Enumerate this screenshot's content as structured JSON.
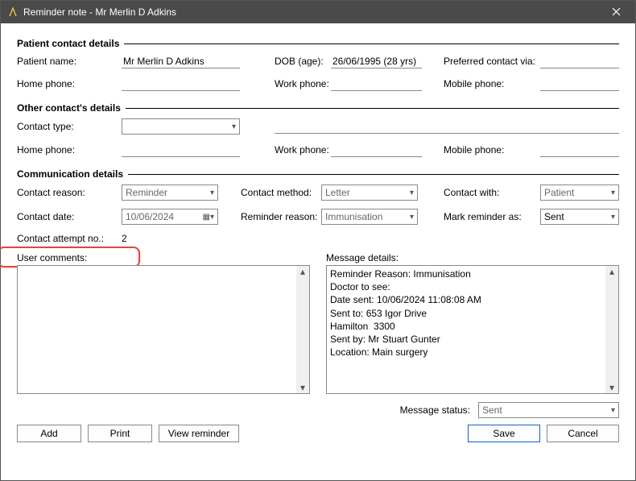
{
  "window": {
    "title": "Reminder note - Mr Merlin D Adkins"
  },
  "sections": {
    "patient": "Patient contact details",
    "other": "Other contact's details",
    "comm": "Communication details"
  },
  "labels": {
    "patient_name": "Patient name:",
    "dob": "DOB (age):",
    "preferred_contact": "Preferred contact via:",
    "home_phone": "Home phone:",
    "work_phone": "Work phone:",
    "mobile_phone": "Mobile phone:",
    "contact_type": "Contact type:",
    "contact_reason": "Contact reason:",
    "contact_method": "Contact method:",
    "contact_with": "Contact with:",
    "contact_date": "Contact date:",
    "reminder_reason": "Reminder reason:",
    "mark_reminder_as": "Mark reminder as:",
    "contact_attempt": "Contact attempt no.:",
    "user_comments": "User comments:",
    "message_details": "Message details:",
    "message_status": "Message status:"
  },
  "values": {
    "patient_name": "Mr Merlin D Adkins",
    "dob": "26/06/1995 (28 yrs)",
    "preferred_contact": "",
    "p_home_phone": "",
    "p_work_phone": "",
    "p_mobile_phone": "",
    "contact_type": "",
    "other_name": "",
    "o_home_phone": "",
    "o_work_phone": "",
    "o_mobile_phone": "",
    "contact_reason": "Reminder",
    "contact_method": "Letter",
    "contact_with": "Patient",
    "contact_date": "10/06/2024",
    "reminder_reason": "Immunisation",
    "mark_reminder_as": "Sent",
    "contact_attempt": "2",
    "user_comments": "",
    "message_details": "Reminder Reason: Immunisation\nDoctor to see:\nDate sent: 10/06/2024 11:08:08 AM\nSent to: 653 Igor Drive\nHamilton  3300\nSent by: Mr Stuart Gunter\nLocation: Main surgery",
    "message_status": "Sent"
  },
  "buttons": {
    "add": "Add",
    "print": "Print",
    "view_reminder": "View reminder",
    "save": "Save",
    "cancel": "Cancel"
  }
}
